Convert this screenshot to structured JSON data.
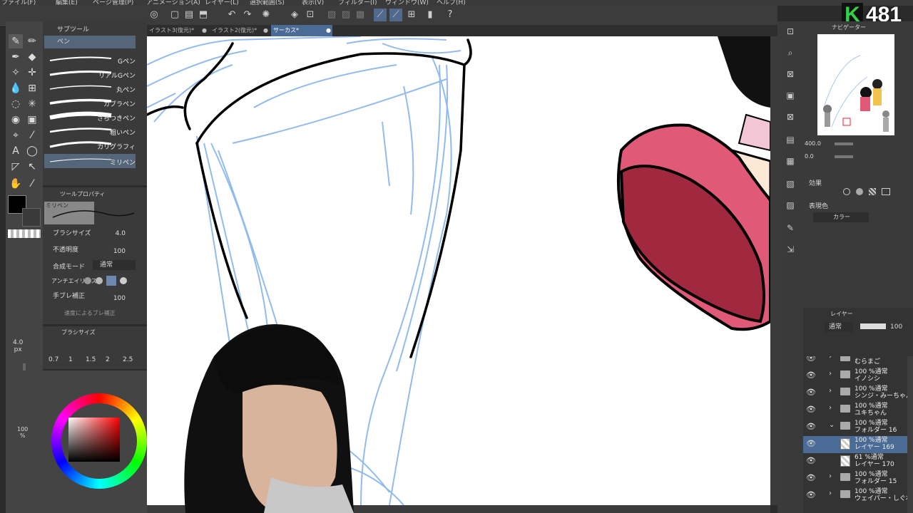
{
  "menu": [
    "ファイル(F)",
    "編集(E)",
    "ページ管理(P)",
    "アニメーション(A)",
    "レイヤー(L)",
    "選択範囲(S)",
    "表示(V)",
    "フィルター(I)",
    "ウィンドウ(W)",
    "ヘルプ(H)"
  ],
  "doc_tabs": [
    "イラスト3(復元)*",
    "イラスト2(復元)*",
    "サーカス*"
  ],
  "subtool": {
    "header": "サブツール",
    "group": "ペン",
    "brushes": [
      "Gペン",
      "リアルGペン",
      "丸ペン",
      "カブラペン",
      "さらつきペン",
      "粗いペン",
      "カリグラフィ",
      "ミリペン"
    ]
  },
  "tool_property": {
    "header": "ツールプロパティ",
    "preset": "ミリペン",
    "brush_size_label": "ブラシサイズ",
    "brush_size_value": "4.0",
    "opacity_label": "不透明度",
    "opacity_value": "100",
    "blend_label": "合成モード",
    "blend_value": "通常",
    "antialias_label": "アンチエイリアス",
    "stabilize_label": "手ブレ補正",
    "stabilize_value": "100",
    "extra_label": "速度によるブレ補正"
  },
  "brush_size_panel": {
    "header": "ブラシサイズ",
    "current": "4.0",
    "unit": "px",
    "sizes": [
      "0.7",
      "1",
      "1.5",
      "2",
      "2.5"
    ]
  },
  "color": {
    "main": "#000000",
    "percent": "100",
    "unit": "%"
  },
  "navigator": {
    "header": "ナビゲーター",
    "zoom": "400.0",
    "angle": "0.0"
  },
  "effect": {
    "header": "効果",
    "expression_label": "表現色",
    "expression_value": "カラー"
  },
  "layers": {
    "header": "レイヤー",
    "blend": "通常",
    "opacity": "100",
    "items": [
      {
        "line1": "",
        "line2": "むらまご",
        "type": "folder",
        "open": false,
        "active": false
      },
      {
        "line1": "100 %通常",
        "line2": "イノシシ",
        "type": "folder",
        "open": false,
        "active": false
      },
      {
        "line1": "100 %通常",
        "line2": "シンジ・みーちゃん",
        "type": "folder",
        "open": false,
        "active": false
      },
      {
        "line1": "100 %通常",
        "line2": "ユキちゃん",
        "type": "folder",
        "open": false,
        "active": false
      },
      {
        "line1": "100 %通常",
        "line2": "フォルダー 16",
        "type": "folder",
        "open": true,
        "active": false
      },
      {
        "line1": "100 %通常",
        "line2": "レイヤー 169",
        "type": "layer",
        "open": false,
        "active": true
      },
      {
        "line1": "61 %通常",
        "line2": "レイヤー 170",
        "type": "layer",
        "open": false,
        "active": false
      },
      {
        "line1": "100 %通常",
        "line2": "フォルダー 15",
        "type": "folder",
        "open": false,
        "active": false
      },
      {
        "line1": "100 %通常",
        "line2": "ウェイパー・しぐれ",
        "type": "folder",
        "open": false,
        "active": false
      }
    ]
  },
  "overlay": {
    "logo": "K",
    "count": "481"
  },
  "colors": {
    "accent": "#4a6b95",
    "score_green": "#35d04a",
    "shoe_red": "#e05a78",
    "sole": "#a0283f",
    "sketch_blue": "#7fb0ea"
  }
}
